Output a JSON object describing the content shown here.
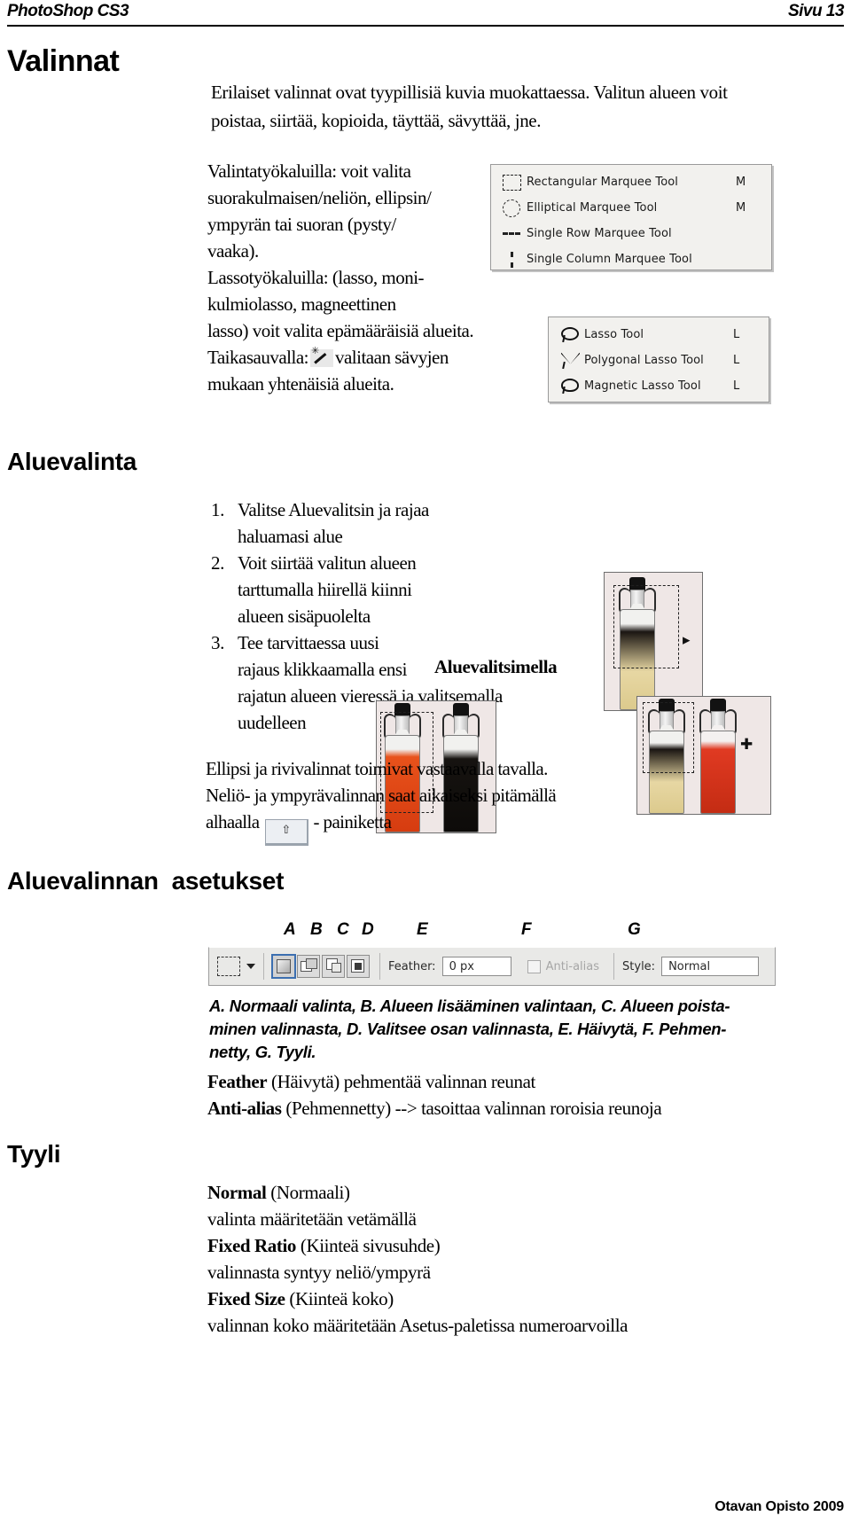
{
  "header": {
    "left": "PhotoShop CS3",
    "right": "Sivu 13"
  },
  "titles": {
    "valinnat": "Valinnat",
    "aluevalinta": "Aluevalinta",
    "aluevalinnan_asetukset": "Aluevalinnan  asetukset",
    "tyyli": "Tyyli"
  },
  "intro": "Erilaiset valinnat ovat tyypillisiä kuvia muokattaessa. Valitun alueen voit poistaa, siirtää, kopioida, täyttää, sävyttää, jne.",
  "tools_desc": {
    "l1": "Valintatyökaluilla:  voit valita",
    "l2": "suorakulmaisen/neliön, ellipsin/",
    "l3": "ympyrän tai suoran (pysty/",
    "l4": "vaaka).",
    "l5": "Lassotyökaluilla:  (lasso, moni-",
    "l6": "kulmiolasso, magneettinen",
    "l7": "lasso) voit valita epämääräisiä alueita.",
    "l8_pre": "Taikasauvalla:",
    "l8_post": "valitaan sävyjen",
    "l9": "mukaan yhtenäisiä alueita."
  },
  "marquee_menu": {
    "items": [
      {
        "icon": "rectangular-marquee-icon",
        "label": "Rectangular Marquee Tool",
        "shortcut": "M"
      },
      {
        "icon": "elliptical-marquee-icon",
        "label": "Elliptical Marquee Tool",
        "shortcut": "M"
      },
      {
        "icon": "single-row-marquee-icon",
        "label": "Single Row Marquee Tool",
        "shortcut": ""
      },
      {
        "icon": "single-column-marquee-icon",
        "label": "Single Column Marquee Tool",
        "shortcut": ""
      }
    ]
  },
  "lasso_menu": {
    "items": [
      {
        "icon": "lasso-icon",
        "label": "Lasso Tool",
        "shortcut": "L"
      },
      {
        "icon": "polygonal-lasso-icon",
        "label": "Polygonal Lasso Tool",
        "shortcut": "L"
      },
      {
        "icon": "magnetic-lasso-icon",
        "label": "Magnetic Lasso Tool",
        "shortcut": "L"
      }
    ]
  },
  "steps": [
    {
      "num": "1.",
      "lines": [
        "Valitse Aluevalitsin ja rajaa",
        "haluamasi alue"
      ]
    },
    {
      "num": "2.",
      "lines": [
        "Voit siirtää valitun alueen",
        "tarttumalla hiirellä kiinni",
        "alueen sisäpuolelta"
      ]
    },
    {
      "num": "3.",
      "lines": [
        "Tee tarvittaessa uusi",
        "rajaus klikkaamalla ensi",
        "rajatun alueen vieressä ja valitsemalla",
        "uudelleen"
      ]
    }
  ],
  "callout": "Aluevalitsimella",
  "ellipse_para": {
    "l1": "Ellipsi ja rivivalinnat toimivat vastaavalla tavalla.",
    "l2": "Neliö- ja ympyrävalinnan saat aikaiseksi pitämällä",
    "l3_pre": "alhaalla",
    "l3_key": "⇧",
    "l3_post": "- painiketta"
  },
  "abc_labels": [
    "A",
    "B",
    "C",
    "D",
    "E",
    "F",
    "G"
  ],
  "options_bar": {
    "feather_label": "Feather:",
    "feather_value": "0 px",
    "antialias_label": "Anti-alias",
    "antialias_checked": false,
    "style_label": "Style:",
    "style_value": "Normal",
    "selection_modes": [
      "new-selection",
      "add-to-selection",
      "subtract-from-selection",
      "intersect-with-selection"
    ],
    "active_mode": "new-selection"
  },
  "legend_caption": {
    "l1": "A. Normaali valinta,  B. Alueen lisääminen valintaan, C. Alueen poista-",
    "l2": "minen valinnasta,  D. Valitsee osan valinnasta, E. Häivytä, F. Pehmen-",
    "l3": "netty, G. Tyyli."
  },
  "feather_expl": {
    "l1_bold": "Feather",
    "l1_rest": " (Häivytä) pehmentää valinnan reunat",
    "l2_bold": "Anti-alias",
    "l2_rest": "  (Pehmennetty) --> tasoittaa valinnan roroisia reunoja"
  },
  "tyyli_body": {
    "l1_bold": "Normal",
    "l1_rest": " (Normaali)",
    "l2": "valinta määritetään vetämällä",
    "l3_bold": "Fixed Ratio",
    "l3_rest": " (Kiinteä sivusuhde)",
    "l4": "valinnasta syntyy neliö/ympyrä",
    "l5_bold": "Fixed Size",
    "l5_rest": " (Kiinteä koko)",
    "l6": "valinnan koko määritetään Asetus-paletissa numeroarvoilla"
  },
  "footer": "Otavan Opisto 2009"
}
